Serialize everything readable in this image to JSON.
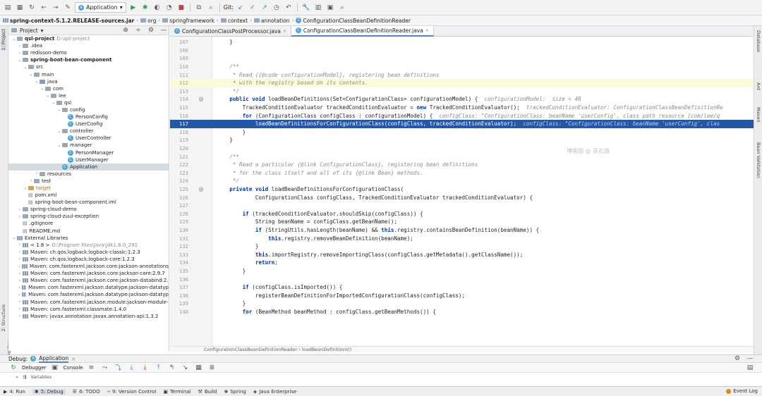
{
  "toolbar": {
    "run_config": "Application",
    "git_label": "Git:"
  },
  "navbar": {
    "crumbs": [
      "spring-context-5.1.2.RELEASE-sources.jar",
      "org",
      "springframework",
      "context",
      "annotation",
      "ConfigurationClassBeanDefinitionReader"
    ]
  },
  "project": {
    "header": "Project",
    "tree": [
      {
        "level": 0,
        "arrow": "v",
        "icon": "folder",
        "label": "qsl-project",
        "extra": "D:\\qsl-project",
        "bold": true
      },
      {
        "level": 1,
        "arrow": ">",
        "icon": "folder",
        "label": ".idea"
      },
      {
        "level": 1,
        "arrow": ">",
        "icon": "folder",
        "label": "redisson-demo"
      },
      {
        "level": 1,
        "arrow": "v",
        "icon": "folder",
        "label": "spring-boot-bean-component",
        "bold": true
      },
      {
        "level": 2,
        "arrow": "v",
        "icon": "folder",
        "label": "src"
      },
      {
        "level": 3,
        "arrow": "v",
        "icon": "folder",
        "label": "main"
      },
      {
        "level": 4,
        "arrow": "v",
        "icon": "folder-blue",
        "label": "java"
      },
      {
        "level": 5,
        "arrow": "v",
        "icon": "folder",
        "label": "com"
      },
      {
        "level": 6,
        "arrow": "v",
        "icon": "folder",
        "label": "lee"
      },
      {
        "level": 7,
        "arrow": "v",
        "icon": "folder",
        "label": "qsl"
      },
      {
        "level": 8,
        "arrow": "v",
        "icon": "folder",
        "label": "config"
      },
      {
        "level": 9,
        "arrow": "",
        "icon": "class",
        "label": "PersonConfig"
      },
      {
        "level": 9,
        "arrow": "",
        "icon": "class",
        "label": "UserConfig"
      },
      {
        "level": 8,
        "arrow": "v",
        "icon": "folder",
        "label": "controller"
      },
      {
        "level": 9,
        "arrow": "",
        "icon": "class",
        "label": "UserController"
      },
      {
        "level": 8,
        "arrow": "v",
        "icon": "folder",
        "label": "manager"
      },
      {
        "level": 9,
        "arrow": "",
        "icon": "class",
        "label": "PersonManager"
      },
      {
        "level": 9,
        "arrow": "",
        "icon": "class",
        "label": "UserManager"
      },
      {
        "level": 8,
        "arrow": "",
        "icon": "class",
        "label": "Application",
        "selected": true
      },
      {
        "level": 4,
        "arrow": ">",
        "icon": "folder",
        "label": "resources"
      },
      {
        "level": 3,
        "arrow": ">",
        "icon": "folder",
        "label": "test"
      },
      {
        "level": 2,
        "arrow": ">",
        "icon": "folder-orange",
        "label": "target"
      },
      {
        "level": 2,
        "arrow": "",
        "icon": "file",
        "label": "pom.xml"
      },
      {
        "level": 2,
        "arrow": "",
        "icon": "file",
        "label": "spring-boot-bean-component.iml"
      },
      {
        "level": 1,
        "arrow": ">",
        "icon": "folder",
        "label": "spring-cloud-demo"
      },
      {
        "level": 1,
        "arrow": ">",
        "icon": "folder",
        "label": "spring-cloud-zuul-exception"
      },
      {
        "level": 1,
        "arrow": "",
        "icon": "file",
        "label": ".gitignore"
      },
      {
        "level": 1,
        "arrow": "",
        "icon": "file",
        "label": "README.md"
      },
      {
        "level": 0,
        "arrow": "v",
        "icon": "lib",
        "label": "External Libraries"
      },
      {
        "level": 1,
        "arrow": ">",
        "icon": "lib",
        "label": "< 1.8 >",
        "extra": "D:\\Program Files\\Java\\jdk1.8.0_291"
      },
      {
        "level": 1,
        "arrow": ">",
        "icon": "lib",
        "label": "Maven: ch.qos.logback:logback-classic:1.2.3"
      },
      {
        "level": 1,
        "arrow": ">",
        "icon": "lib",
        "label": "Maven: ch.qos.logback:logback-core:1.2.3"
      },
      {
        "level": 1,
        "arrow": ">",
        "icon": "lib",
        "label": "Maven: com.fasterxml.jackson.core:jackson-annotations"
      },
      {
        "level": 1,
        "arrow": ">",
        "icon": "lib",
        "label": "Maven: com.fasterxml.jackson.core:jackson-core:2.9.7"
      },
      {
        "level": 1,
        "arrow": ">",
        "icon": "lib",
        "label": "Maven: com.fasterxml.jackson.core:jackson-databind:2."
      },
      {
        "level": 1,
        "arrow": ">",
        "icon": "lib",
        "label": "Maven: com.fasterxml.jackson.datatype:jackson-datatyp"
      },
      {
        "level": 1,
        "arrow": ">",
        "icon": "lib",
        "label": "Maven: com.fasterxml.jackson.datatype:jackson-datatyp"
      },
      {
        "level": 1,
        "arrow": ">",
        "icon": "lib",
        "label": "Maven: com.fasterxml.jackson.module:jackson-module-"
      },
      {
        "level": 1,
        "arrow": ">",
        "icon": "lib",
        "label": "Maven: com.fasterxml:classmate:1.4.0"
      },
      {
        "level": 1,
        "arrow": ">",
        "icon": "lib",
        "label": "Maven: javax.annotation:javax.annotation-api:1.3.2"
      }
    ]
  },
  "editor": {
    "tabs": [
      {
        "label": "ConfigurationClassPostProcessor.java",
        "active": false
      },
      {
        "label": "ConfigurationClassBeanDefinitionReader.java",
        "active": true
      }
    ],
    "watermark": "博客园 @ 青石路",
    "lines": [
      {
        "n": "107",
        "mark": "",
        "cls": "",
        "segs": [
          [
            "",
            "    }"
          ]
        ]
      },
      {
        "n": "108",
        "mark": "",
        "cls": "",
        "segs": [
          [
            "",
            ""
          ]
        ]
      },
      {
        "n": "109",
        "mark": "",
        "cls": "",
        "segs": [
          [
            "",
            ""
          ]
        ]
      },
      {
        "n": "110",
        "mark": "",
        "cls": "",
        "segs": [
          [
            "cmt",
            "    /**"
          ]
        ]
      },
      {
        "n": "111",
        "mark": "",
        "cls": "",
        "segs": [
          [
            "cmt",
            "     * Read ({@code configurationModel}, registering bean definitions"
          ]
        ]
      },
      {
        "n": "112",
        "mark": "",
        "cls": "hl",
        "segs": [
          [
            "cmt",
            "     * with the registry based on its contents."
          ]
        ]
      },
      {
        "n": "113",
        "mark": "",
        "cls": "",
        "segs": [
          [
            "cmt",
            "     */"
          ]
        ]
      },
      {
        "n": "114",
        "mark": "@",
        "cls": "",
        "segs": [
          [
            "kw",
            "    public void "
          ],
          [
            "",
            "loadBeanDefinitions(Set<ConfigurationClass> configurationModel) {  "
          ],
          [
            "hint",
            "configurationModel:  size = 46"
          ]
        ]
      },
      {
        "n": "115",
        "mark": "",
        "cls": "",
        "segs": [
          [
            "",
            "        TrackedConditionEvaluator trackedConditionEvaluator = "
          ],
          [
            "kw",
            "new "
          ],
          [
            "",
            "TrackedConditionEvaluator();  "
          ],
          [
            "hint",
            "trackedConditionEvaluator: ConfigurationClassBeanDefinitionRe"
          ]
        ]
      },
      {
        "n": "116",
        "mark": "",
        "cls": "",
        "segs": [
          [
            "kw",
            "        for "
          ],
          [
            "",
            "(ConfigurationClass configClass : configurationModel) {  "
          ],
          [
            "hint",
            "configClass: \"ConfigurationClass: beanName 'userConfig', class path resource [com/lee/q"
          ]
        ]
      },
      {
        "n": "117",
        "mark": "",
        "cls": "sel",
        "segs": [
          [
            "",
            "            loadBeanDefinitionsForConfigurationClass(configClass, trackedConditionEvaluator);  "
          ],
          [
            "hint",
            "configClass: \"ConfigurationClass: beanName 'userConfig', clas"
          ]
        ]
      },
      {
        "n": "118",
        "mark": "",
        "cls": "",
        "segs": [
          [
            "",
            "        }"
          ]
        ]
      },
      {
        "n": "119",
        "mark": "",
        "cls": "",
        "segs": [
          [
            "",
            "    }"
          ]
        ]
      },
      {
        "n": "120",
        "mark": "",
        "cls": "",
        "segs": [
          [
            "",
            ""
          ]
        ]
      },
      {
        "n": "121",
        "mark": "",
        "cls": "",
        "segs": [
          [
            "cmt",
            "    /**"
          ]
        ]
      },
      {
        "n": "122",
        "mark": "",
        "cls": "",
        "segs": [
          [
            "cmt",
            "     * Read a particular {@link ConfigurationClass}, registering bean definitions"
          ]
        ]
      },
      {
        "n": "123",
        "mark": "",
        "cls": "",
        "segs": [
          [
            "cmt",
            "     * for the class itself and all of its {@link Bean} methods."
          ]
        ]
      },
      {
        "n": "124",
        "mark": "",
        "cls": "",
        "segs": [
          [
            "cmt",
            "     */"
          ]
        ]
      },
      {
        "n": "125",
        "mark": "@",
        "cls": "",
        "segs": [
          [
            "kw",
            "    private void "
          ],
          [
            "",
            "loadBeanDefinitionsForConfigurationClass("
          ]
        ]
      },
      {
        "n": "126",
        "mark": "",
        "cls": "",
        "segs": [
          [
            "",
            "            ConfigurationClass configClass, TrackedConditionEvaluator trackedConditionEvaluator) {"
          ]
        ]
      },
      {
        "n": "127",
        "mark": "",
        "cls": "",
        "segs": [
          [
            "",
            ""
          ]
        ]
      },
      {
        "n": "128",
        "mark": "",
        "cls": "",
        "segs": [
          [
            "kw",
            "        if "
          ],
          [
            "",
            "(trackedConditionEvaluator.shouldSkip(configClass)) {"
          ]
        ]
      },
      {
        "n": "129",
        "mark": "",
        "cls": "",
        "segs": [
          [
            "",
            "            String beanName = configClass.getBeanName();"
          ]
        ]
      },
      {
        "n": "130",
        "mark": "",
        "cls": "",
        "segs": [
          [
            "kw",
            "            if "
          ],
          [
            "",
            "(StringUtils.hasLength(beanName) && "
          ],
          [
            "kw",
            "this"
          ],
          [
            "",
            ".registry.containsBeanDefinition(beanName)) {"
          ]
        ]
      },
      {
        "n": "131",
        "mark": "",
        "cls": "",
        "segs": [
          [
            "kw",
            "                this"
          ],
          [
            "",
            ".registry.removeBeanDefinition(beanName);"
          ]
        ]
      },
      {
        "n": "132",
        "mark": "",
        "cls": "",
        "segs": [
          [
            "",
            "            }"
          ]
        ]
      },
      {
        "n": "133",
        "mark": "",
        "cls": "",
        "segs": [
          [
            "kw",
            "            this"
          ],
          [
            "",
            ".importRegistry.removeImportingClass(configClass.getMetadata().getClassName());"
          ]
        ]
      },
      {
        "n": "134",
        "mark": "",
        "cls": "",
        "segs": [
          [
            "kw",
            "            return"
          ],
          [
            "",
            ";"
          ]
        ]
      },
      {
        "n": "135",
        "mark": "",
        "cls": "",
        "segs": [
          [
            "",
            "        }"
          ]
        ]
      },
      {
        "n": "136",
        "mark": "",
        "cls": "",
        "segs": [
          [
            "",
            ""
          ]
        ]
      },
      {
        "n": "137",
        "mark": "",
        "cls": "",
        "segs": [
          [
            "kw",
            "        if "
          ],
          [
            "",
            "(configClass.isImported()) {"
          ]
        ]
      },
      {
        "n": "138",
        "mark": "",
        "cls": "",
        "segs": [
          [
            "",
            "            registerBeanDefinitionForImportedConfigurationClass(configClass);"
          ]
        ]
      },
      {
        "n": "139",
        "mark": "",
        "cls": "",
        "segs": [
          [
            "",
            "        }"
          ]
        ]
      },
      {
        "n": "140",
        "mark": "",
        "cls": "",
        "segs": [
          [
            "kw",
            "        for "
          ],
          [
            "",
            "(BeanMethod beanMethod : configClass.getBeanMethods()) {"
          ]
        ]
      }
    ],
    "breadcrumb": "ConfigurationClassBeanDefinitionReader  ›  loadBeanDefinitions()"
  },
  "debug": {
    "title": "Debug:",
    "config": "Application",
    "tabs": [
      "Debugger",
      "Console"
    ],
    "sub": [
      "Variables"
    ]
  },
  "left_strip": [
    "1: Project",
    "2: Structure",
    "2: Favorites",
    "Web"
  ],
  "right_strip": [
    "Database",
    "Ant",
    "Maven",
    "Bean Validation"
  ],
  "statusbar": {
    "items": [
      {
        "label": "4: Run",
        "active": false
      },
      {
        "label": "5: Debug",
        "active": true
      },
      {
        "label": "6: TODO",
        "active": false
      },
      {
        "label": "9: Version Control",
        "active": false
      },
      {
        "label": "Terminal",
        "active": false
      },
      {
        "label": "Build",
        "active": false
      },
      {
        "label": "Spring",
        "active": false
      },
      {
        "label": "Java Enterprise",
        "active": false
      }
    ],
    "event_log": "Event Log"
  }
}
